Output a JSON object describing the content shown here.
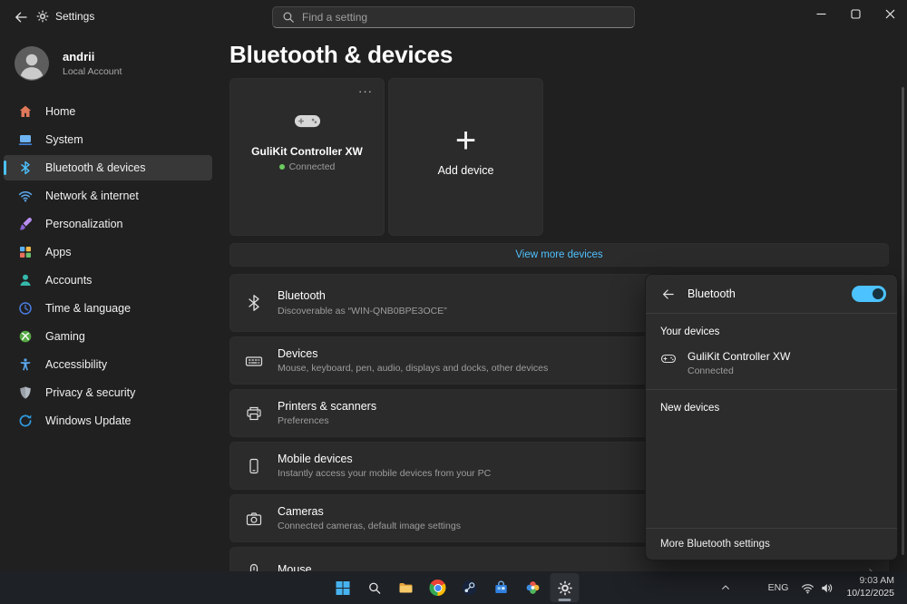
{
  "titlebar": {
    "title": "Settings"
  },
  "search": {
    "placeholder": "Find a setting"
  },
  "user": {
    "name": "andrii",
    "type": "Local Account"
  },
  "sidebar": {
    "items": [
      {
        "label": "Home",
        "icon": "home-icon",
        "selected": false
      },
      {
        "label": "System",
        "icon": "system-icon",
        "selected": false
      },
      {
        "label": "Bluetooth & devices",
        "icon": "bluetooth-icon",
        "selected": true
      },
      {
        "label": "Network & internet",
        "icon": "network-icon",
        "selected": false
      },
      {
        "label": "Personalization",
        "icon": "personalization-icon",
        "selected": false
      },
      {
        "label": "Apps",
        "icon": "apps-icon",
        "selected": false
      },
      {
        "label": "Accounts",
        "icon": "accounts-icon",
        "selected": false
      },
      {
        "label": "Time & language",
        "icon": "time-language-icon",
        "selected": false
      },
      {
        "label": "Gaming",
        "icon": "gaming-icon",
        "selected": false
      },
      {
        "label": "Accessibility",
        "icon": "accessibility-icon",
        "selected": false
      },
      {
        "label": "Privacy & security",
        "icon": "privacy-icon",
        "selected": false
      },
      {
        "label": "Windows Update",
        "icon": "windows-update-icon",
        "selected": false
      }
    ]
  },
  "page": {
    "title": "Bluetooth & devices",
    "cards": {
      "device": {
        "name": "GuliKit Controller XW",
        "status": "Connected",
        "icon": "gamepad-icon"
      },
      "add": {
        "label": "Add device",
        "icon": "plus-icon"
      }
    },
    "view_more_label": "View more devices",
    "rows": [
      {
        "title": "Bluetooth",
        "subtitle": "Discoverable as “WIN-QNB0BPE3OCE”",
        "icon": "bluetooth-icon"
      },
      {
        "title": "Devices",
        "subtitle": "Mouse, keyboard, pen, audio, displays and docks, other devices",
        "icon": "devices-icon"
      },
      {
        "title": "Printers & scanners",
        "subtitle": "Preferences",
        "icon": "printer-icon"
      },
      {
        "title": "Mobile devices",
        "subtitle": "Instantly access your mobile devices from your PC",
        "icon": "mobile-icon"
      },
      {
        "title": "Cameras",
        "subtitle": "Connected cameras, default image settings",
        "icon": "camera-icon"
      },
      {
        "title": "Mouse",
        "subtitle": "",
        "icon": "mouse-icon"
      }
    ]
  },
  "flyout": {
    "title": "Bluetooth",
    "toggle_on": true,
    "your_devices_header": "Your devices",
    "devices": [
      {
        "name": "GuliKit Controller XW",
        "status": "Connected",
        "icon": "gamepad-icon"
      }
    ],
    "new_devices_header": "New devices",
    "footer_link": "More Bluetooth settings"
  },
  "taskbar": {
    "language": "ENG",
    "time": "9:03 AM",
    "date": "10/12/2025",
    "icon_names": [
      "hidden-icons-chevron",
      "start-icon",
      "search-icon",
      "file-explorer-icon",
      "chrome-icon",
      "steam-icon",
      "store-icon",
      "photos-icon",
      "gear-icon",
      "wifi-icon",
      "volume-icon"
    ]
  },
  "icons": {
    "more": "···",
    "plus": "+",
    "chevron_right": "›"
  },
  "colors": {
    "accent": "#4cc2ff",
    "connected_green": "#6ccb5f"
  }
}
